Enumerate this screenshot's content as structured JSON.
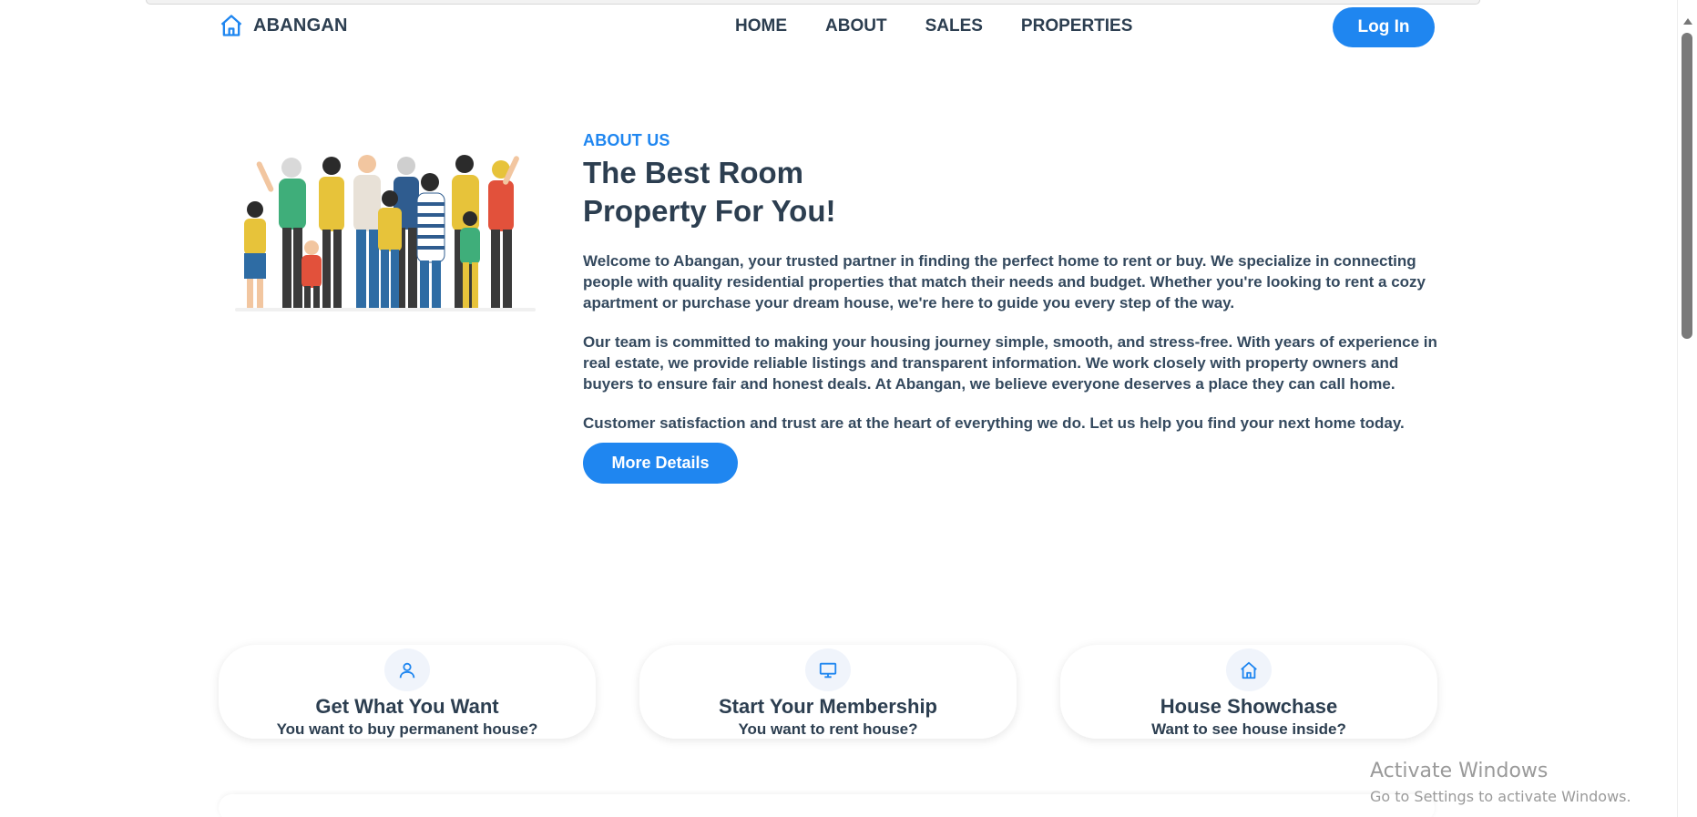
{
  "nav": {
    "brand": "ABANGAN",
    "links": [
      "HOME",
      "ABOUT",
      "SALES",
      "PROPERTIES"
    ],
    "login": "Log In"
  },
  "about": {
    "tag": "ABOUT US",
    "title": "The Best Room Property For You!",
    "paragraphs": [
      "Welcome to Abangan, your trusted partner in finding the perfect home to rent or buy. We specialize in connecting people with quality residential properties that match their needs and budget. Whether you're looking to rent a cozy apartment or purchase your dream house, we're here to guide you every step of the way.",
      "Our team is committed to making your housing journey simple, smooth, and stress-free. With years of experience in real estate, we provide reliable listings and transparent information. We work closely with property owners and buyers to ensure fair and honest deals. At Abangan, we believe everyone deserves a place they can call home.",
      "Customer satisfaction and trust are at the heart of everything we do. Let us help you find your next home today."
    ],
    "button": "More Details"
  },
  "cards": [
    {
      "icon": "user-icon",
      "title": "Get What You Want",
      "subtitle": "You want to buy permanent house?"
    },
    {
      "icon": "monitor-icon",
      "title": "Start Your Membership",
      "subtitle": "You want to rent house?"
    },
    {
      "icon": "home-icon",
      "title": "House Showchase",
      "subtitle": "Want to see house inside?"
    }
  ],
  "watermark": {
    "title": "Activate Windows",
    "subtitle": "Go to Settings to activate Windows."
  },
  "colors": {
    "accent": "#1f86f0",
    "text": "#2c3e50"
  }
}
